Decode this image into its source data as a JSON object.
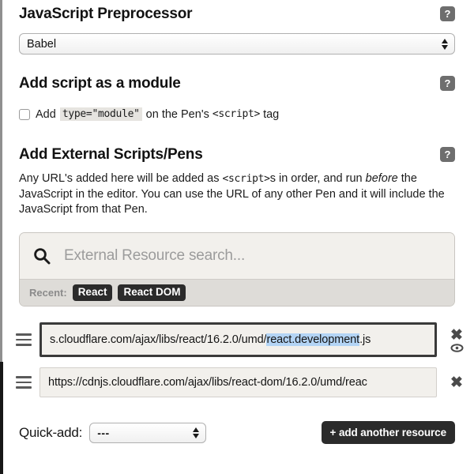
{
  "preprocessor": {
    "title": "JavaScript Preprocessor",
    "help_icon": "help-icon",
    "selected": "Babel"
  },
  "module": {
    "title": "Add script as a module",
    "help_icon": "help-icon",
    "checkbox_checked": false,
    "label_before": "Add",
    "code_attr": "type=\"module\"",
    "label_middle": "on the Pen's",
    "code_tag": "<script>",
    "label_after": "tag"
  },
  "external": {
    "title": "Add External Scripts/Pens",
    "help_icon": "help-icon",
    "description_part1": "Any URL's added here will be added as ",
    "description_code": "<script>",
    "description_part2": "s in order, and run ",
    "description_em": "before",
    "description_part3": " the JavaScript in the editor. You can use the URL of any other Pen and it will include the JavaScript from that Pen."
  },
  "search": {
    "icon": "search-icon",
    "placeholder": "External Resource search...",
    "value": "",
    "recent_label": "Recent:",
    "recent_tags": [
      "React",
      "React DOM"
    ]
  },
  "resources": [
    {
      "drag_icon": "drag-handle-icon",
      "text_before_selection": "s.cloudflare.com/ajax/libs/react/16.2.0/umd/",
      "selected_text": "react.development",
      "text_after_selection": ".js",
      "focused": true,
      "delete_icon": "close-icon",
      "preview_icon": "eye-icon"
    },
    {
      "drag_icon": "drag-handle-icon",
      "text_before_selection": "https://cdnjs.cloudflare.com/ajax/libs/react-dom/16.2.0/umd/reac",
      "selected_text": "",
      "text_after_selection": "",
      "focused": false,
      "delete_icon": "close-icon",
      "preview_icon": ""
    }
  ],
  "quick_add": {
    "label": "Quick-add:",
    "selected": "---"
  },
  "add_button": {
    "label": "+ add another resource"
  },
  "colors": {
    "accent_dark": "#2b2b2b",
    "selection_blue": "#b3d4f5",
    "panel_bg": "#f2f0ec",
    "recent_bar": "#dedcd8",
    "focus_border": "#3a3a3a"
  }
}
